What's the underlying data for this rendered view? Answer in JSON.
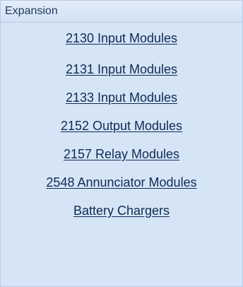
{
  "panel": {
    "header": "Expansion",
    "links": [
      "2130 Input Modules",
      "2131 Input Modules",
      "2133 Input Modules",
      "2152 Output Modules",
      "2157 Relay Modules",
      "2548 Annunciator Modules",
      "Battery Chargers"
    ]
  },
  "colors": {
    "panel_bg": "#d6e5f5",
    "border": "#b7c9e2",
    "header_text": "#1e395b",
    "link_text": "#0e2a56"
  }
}
